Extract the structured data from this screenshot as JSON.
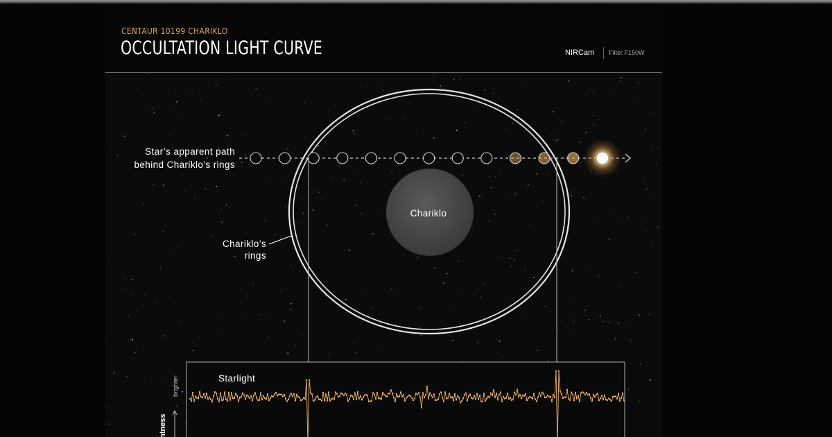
{
  "header": {
    "eyebrow": "CENTAUR 10199 CHARIKLO",
    "title": "OCCULTATION LIGHT CURVE",
    "instrument": "NIRCam",
    "filter": "Filter F150W"
  },
  "diagram": {
    "path_label_line1": "Star’s apparent path",
    "path_label_line2": "behind Chariklo’s rings",
    "body_label": "Chariklo",
    "rings_label_line1": "Chariklo’s",
    "rings_label_line2": "rings",
    "star_positions": 13
  },
  "plot": {
    "series_label": "Starlight",
    "axis_hint": "brighter",
    "ylabel_partial": "ntness"
  },
  "colors": {
    "accent": "#e2a75a",
    "curve": "#f0b565",
    "star": "#fff4dc"
  }
}
